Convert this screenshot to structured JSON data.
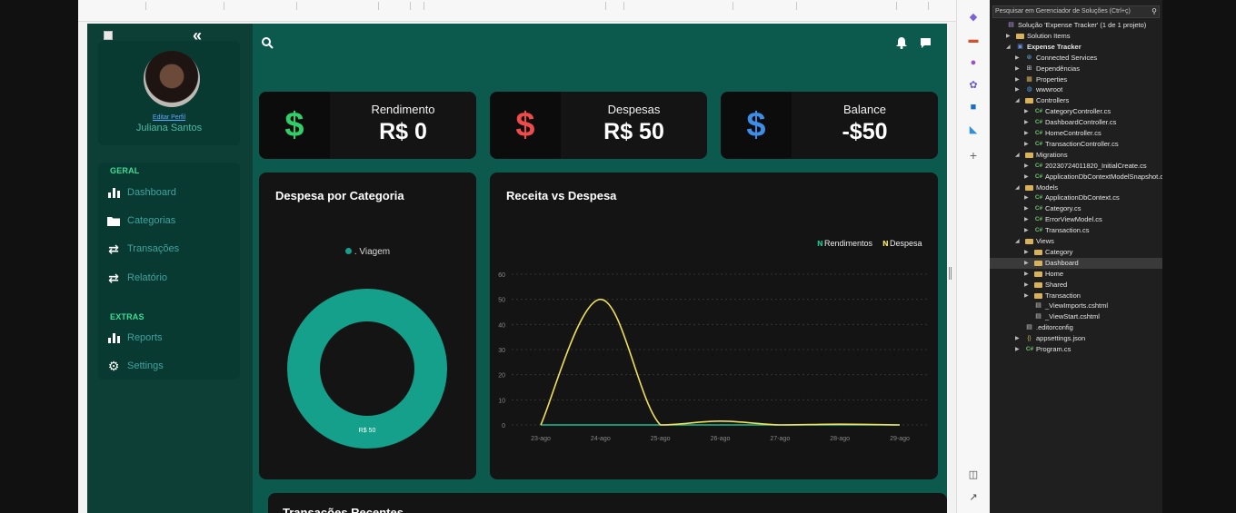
{
  "sidebar": {
    "collapse_icon": "«",
    "profile": {
      "edit_link": "Editar Perfil",
      "name": "Juliana Santos"
    },
    "sections": [
      {
        "heading": "GERAL",
        "items": [
          {
            "label": "Dashboard",
            "icon": "bar-chart-icon"
          },
          {
            "label": "Categorias",
            "icon": "folder-icon"
          },
          {
            "label": "Transações",
            "icon": "transfer-icon"
          },
          {
            "label": "Relatório",
            "icon": "transfer-icon"
          }
        ]
      },
      {
        "heading": "EXTRAS",
        "items": [
          {
            "label": "Reports",
            "icon": "bar-chart-icon"
          },
          {
            "label": "Settings",
            "icon": "gear-icon"
          }
        ]
      }
    ]
  },
  "stats": [
    {
      "label": "Rendimento",
      "value": "R$ 0",
      "symbol": "$",
      "color": "#2fd06a"
    },
    {
      "label": "Despesas",
      "value": "R$ 50",
      "symbol": "$",
      "color": "#ef4b4b"
    },
    {
      "label": "Balance",
      "value": "-$50",
      "symbol": "$",
      "color": "#3d8ee8"
    }
  ],
  "donut_card": {
    "title": "Despesa por Categoria",
    "legend": ". Viagem",
    "slice_label": "R$ 50"
  },
  "line_card": {
    "title": "Receita vs Despesa",
    "legend": [
      "Rendimentos",
      "Despesa"
    ]
  },
  "bottom_card": {
    "title": "Transações Recentes"
  },
  "chart_data": [
    {
      "type": "pie",
      "title": "Despesa por Categoria",
      "categories": [
        "Viagem"
      ],
      "values": [
        50
      ],
      "colors": [
        "#14a08a"
      ],
      "annotations": [
        "R$ 50"
      ]
    },
    {
      "type": "line",
      "title": "Receita vs Despesa",
      "categories": [
        "23-ago",
        "24-ago",
        "25-ago",
        "26-ago",
        "27-ago",
        "28-ago",
        "29-ago"
      ],
      "series": [
        {
          "name": "Rendimentos",
          "values": [
            0,
            0,
            0,
            0,
            0,
            0,
            0
          ],
          "color": "#1dbf8f"
        },
        {
          "name": "Despesa",
          "values": [
            0,
            50,
            0,
            1.5,
            0,
            0.3,
            0
          ],
          "color": "#f0e05a"
        }
      ],
      "ylim": [
        0,
        60
      ],
      "yticks": [
        0,
        10,
        20,
        30,
        40,
        50,
        60
      ],
      "grid": true,
      "legend": "top-right"
    }
  ],
  "solution_explorer": {
    "search_placeholder": "Pesquisar em Gerenciador de Soluções (Ctrl+ç)",
    "rows": [
      {
        "label": "Solução 'Expense Tracker' (1 de 1 projeto)",
        "level": 0,
        "icon": "solution-icon",
        "toggle": ""
      },
      {
        "label": "Solution Items",
        "level": 1,
        "icon": "folder-icon",
        "toggle": "▶"
      },
      {
        "label": "Expense Tracker",
        "level": 1,
        "icon": "project-icon",
        "toggle": "◢",
        "bold": true
      },
      {
        "label": "Connected Services",
        "level": 2,
        "icon": "connected-services-icon",
        "toggle": "▶"
      },
      {
        "label": "Dependências",
        "level": 2,
        "icon": "dependencies-icon",
        "toggle": "▶"
      },
      {
        "label": "Properties",
        "level": 2,
        "icon": "properties-icon",
        "toggle": "▶"
      },
      {
        "label": "wwwroot",
        "level": 2,
        "icon": "globe-icon",
        "toggle": "▶"
      },
      {
        "label": "Controllers",
        "level": 2,
        "icon": "folder-icon",
        "toggle": "◢"
      },
      {
        "label": "CategoryController.cs",
        "level": 3,
        "icon": "csharp-icon",
        "toggle": "▶"
      },
      {
        "label": "DashboardController.cs",
        "level": 3,
        "icon": "csharp-icon",
        "toggle": "▶"
      },
      {
        "label": "HomeController.cs",
        "level": 3,
        "icon": "csharp-icon",
        "toggle": "▶"
      },
      {
        "label": "TransactionController.cs",
        "level": 3,
        "icon": "csharp-icon",
        "toggle": "▶"
      },
      {
        "label": "Migrations",
        "level": 2,
        "icon": "folder-icon",
        "toggle": "◢"
      },
      {
        "label": "20230724011820_InitialCreate.cs",
        "level": 3,
        "icon": "csharp-icon",
        "toggle": "▶"
      },
      {
        "label": "ApplicationDbContextModelSnapshot.c",
        "level": 3,
        "icon": "csharp-icon",
        "toggle": "▶"
      },
      {
        "label": "Models",
        "level": 2,
        "icon": "folder-icon",
        "toggle": "◢"
      },
      {
        "label": "ApplicationDbContext.cs",
        "level": 3,
        "icon": "csharp-icon",
        "toggle": "▶"
      },
      {
        "label": "Category.cs",
        "level": 3,
        "icon": "csharp-icon",
        "toggle": "▶"
      },
      {
        "label": "ErrorViewModel.cs",
        "level": 3,
        "icon": "csharp-icon",
        "toggle": "▶"
      },
      {
        "label": "Transaction.cs",
        "level": 3,
        "icon": "csharp-icon",
        "toggle": "▶"
      },
      {
        "label": "Views",
        "level": 2,
        "icon": "folder-icon",
        "toggle": "◢"
      },
      {
        "label": "Category",
        "level": 3,
        "icon": "folder-icon",
        "toggle": "▶"
      },
      {
        "label": "Dashboard",
        "level": 3,
        "icon": "folder-icon",
        "toggle": "▶",
        "selected": true
      },
      {
        "label": "Home",
        "level": 3,
        "icon": "folder-icon",
        "toggle": "▶"
      },
      {
        "label": "Shared",
        "level": 3,
        "icon": "folder-icon",
        "toggle": "▶"
      },
      {
        "label": "Transaction",
        "level": 3,
        "icon": "folder-icon",
        "toggle": "▶"
      },
      {
        "label": "_ViewImports.cshtml",
        "level": 3,
        "icon": "file-icon",
        "toggle": ""
      },
      {
        "label": "_ViewStart.cshtml",
        "level": 3,
        "icon": "file-icon",
        "toggle": ""
      },
      {
        "label": ".editorconfig",
        "level": 2,
        "icon": "file-icon",
        "toggle": ""
      },
      {
        "label": "appsettings.json",
        "level": 2,
        "icon": "json-icon",
        "toggle": "▶"
      },
      {
        "label": "Program.cs",
        "level": 2,
        "icon": "csharp-icon",
        "toggle": "▶"
      }
    ]
  },
  "toolbar_icons": [
    "copilot-icon",
    "toolbox-icon",
    "team-explorer-icon",
    "extensions-icon",
    "outlook-icon",
    "azure-icon",
    "add-icon",
    "split-view-icon",
    "open-external-icon"
  ]
}
